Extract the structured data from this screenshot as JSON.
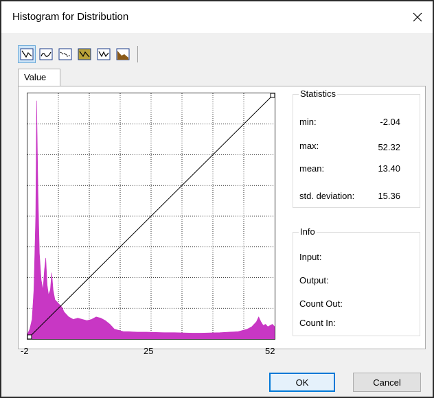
{
  "window": {
    "title": "Histogram for Distribution"
  },
  "toolbar": {
    "buttons": [
      {
        "name": "curve-mode-1",
        "active": true
      },
      {
        "name": "curve-mode-2"
      },
      {
        "name": "curve-mode-3"
      },
      {
        "name": "curve-mode-4"
      },
      {
        "name": "curve-mode-5"
      },
      {
        "name": "curve-mode-6"
      }
    ]
  },
  "tab": {
    "label": "Value"
  },
  "statistics": {
    "title": "Statistics",
    "min_label": "min:",
    "min_value": "-2.04",
    "max_label": "max:",
    "max_value": "52.32",
    "mean_label": "mean:",
    "mean_value": "13.40",
    "std_label": "std. deviation:",
    "std_value": "15.36"
  },
  "info": {
    "title": "Info",
    "input_label": "Input:",
    "output_label": "Output:",
    "count_out_label": "Count Out:",
    "count_in_label": "Count In:"
  },
  "buttons": {
    "ok": "OK",
    "cancel": "Cancel"
  },
  "colors": {
    "histogram": "#c837c4",
    "accent": "#0078d7"
  },
  "chart_data": {
    "type": "area",
    "x_ticks": [
      "-2",
      "25",
      "52"
    ],
    "xlim": [
      -2,
      52
    ],
    "grid": true,
    "series": [
      {
        "x": [
          -2,
          -1.5,
          -1,
          -0.6,
          -0.2,
          0,
          0.3,
          0.6,
          1,
          1.4,
          1.7,
          2,
          2.3,
          2.6,
          3,
          3.3,
          3.6,
          4,
          4.5,
          5,
          5.5,
          6,
          7,
          8,
          9,
          10,
          11,
          12,
          13,
          14,
          15,
          16,
          17,
          18,
          19,
          20,
          22,
          24,
          26,
          28,
          30,
          32,
          34,
          36,
          38,
          40,
          42,
          44,
          45,
          46,
          47,
          48,
          48.5,
          49,
          49.5,
          50,
          50.5,
          51,
          51.5,
          52
        ],
        "y": [
          0.02,
          0.04,
          0.08,
          0.2,
          0.5,
          0.97,
          0.6,
          0.35,
          0.24,
          0.2,
          0.28,
          0.33,
          0.22,
          0.18,
          0.2,
          0.27,
          0.2,
          0.16,
          0.15,
          0.14,
          0.13,
          0.11,
          0.09,
          0.08,
          0.085,
          0.08,
          0.075,
          0.08,
          0.09,
          0.085,
          0.075,
          0.06,
          0.04,
          0.035,
          0.03,
          0.03,
          0.028,
          0.028,
          0.027,
          0.026,
          0.026,
          0.025,
          0.024,
          0.024,
          0.025,
          0.026,
          0.028,
          0.03,
          0.035,
          0.04,
          0.05,
          0.07,
          0.09,
          0.07,
          0.055,
          0.06,
          0.05,
          0.055,
          0.06,
          0.05
        ]
      }
    ],
    "transfer_line": {
      "x": [
        -2,
        52
      ],
      "y": [
        0,
        1
      ]
    }
  }
}
